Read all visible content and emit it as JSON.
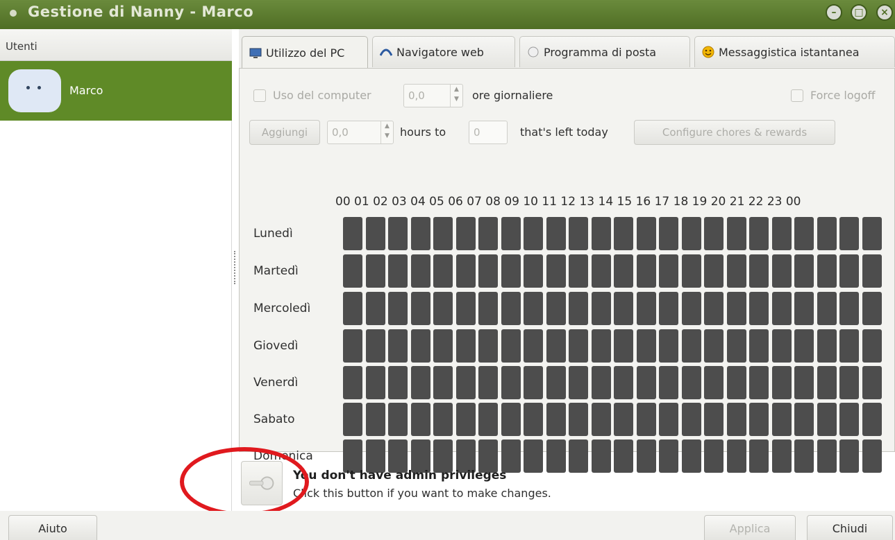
{
  "window": {
    "title": "Gestione di Nanny - Marco",
    "controls": [
      "minimize",
      "maximize",
      "close"
    ],
    "accent_color": "#5f8a27"
  },
  "sidebar": {
    "header": "Utenti",
    "users": [
      {
        "name": "Marco",
        "selected": true
      }
    ]
  },
  "tabs": [
    {
      "label": "Utilizzo del PC",
      "icon": "monitor-icon",
      "active": true
    },
    {
      "label": "Navigatore web",
      "icon": "globe-icon",
      "active": false
    },
    {
      "label": "Programma di posta",
      "icon": "mail-icon",
      "active": false
    },
    {
      "label": "Messaggistica istantanea",
      "icon": "smiley-icon",
      "active": false
    }
  ],
  "usage": {
    "computer_use_label": "Uso del computer",
    "computer_use_value": "0,0",
    "daily_hours_label": "ore giornaliere",
    "force_logoff_label": "Force logoff",
    "add_button": "Aggiungi",
    "add_value": "0,0",
    "hours_to_label": "hours to",
    "hours_to_value": "0",
    "left_today_label": "that's left today",
    "chores_button": "Configure chores & rewards"
  },
  "schedule": {
    "hours_header": "00 01 02 03 04 05 06 07 08 09 10 11 12 13 14 15 16 17 18 19 20 21 22 23 00",
    "days": [
      "Lunedì",
      "Martedì",
      "Mercoledì",
      "Giovedì",
      "Venerdì",
      "Sabato",
      "Domenica"
    ],
    "blocked_color": "#4d4d4d"
  },
  "admin": {
    "title": "You don't have admin privileges",
    "subtitle": "Click this button if you want to make changes."
  },
  "buttons": {
    "help": "Aiuto",
    "apply": "Applica",
    "close": "Chiudi"
  }
}
